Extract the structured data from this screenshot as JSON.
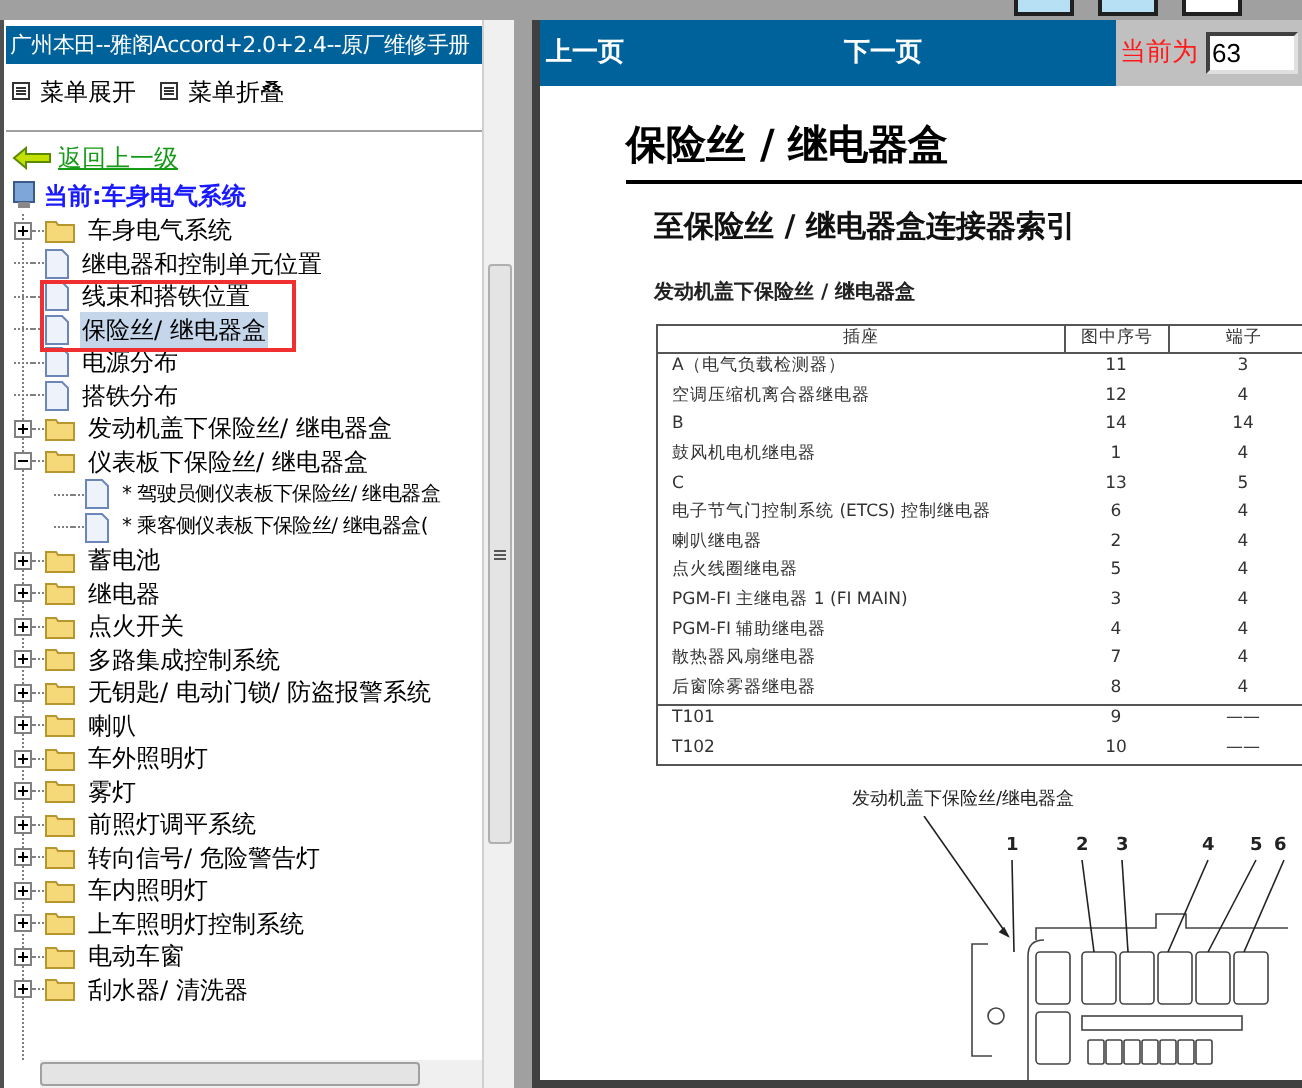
{
  "header": {
    "title": "广州本田--雅阁Accord+2.0+2.4--原厂维修手册"
  },
  "menu": [
    {
      "label": "菜单展开"
    },
    {
      "label": "菜单折叠"
    }
  ],
  "back_link": "返回上一级",
  "current": "当前:车身电气系统",
  "tree": [
    {
      "kind": "folder",
      "label": "车身电气系统",
      "expanded": false,
      "selected": false
    },
    {
      "kind": "doc",
      "label": "继电器和控制单元位置",
      "selected": false
    },
    {
      "kind": "doc",
      "label": "线束和搭铁位置",
      "selected": false
    },
    {
      "kind": "doc",
      "label": "保险丝/ 继电器盒",
      "selected": true
    },
    {
      "kind": "doc",
      "label": "电源分布",
      "selected": false
    },
    {
      "kind": "doc",
      "label": "搭铁分布",
      "selected": false
    },
    {
      "kind": "folder",
      "label": "发动机盖下保险丝/ 继电器盒",
      "expanded": false,
      "selected": false
    },
    {
      "kind": "folder",
      "label": "仪表板下保险丝/ 继电器盒",
      "expanded": true,
      "selected": false,
      "children": [
        {
          "kind": "doc",
          "label": "* 驾驶员侧仪表板下保险丝/ 继电器盒",
          "selected": false
        },
        {
          "kind": "doc",
          "label": "* 乘客侧仪表板下保险丝/ 继电器盒(",
          "selected": false
        }
      ]
    },
    {
      "kind": "folder",
      "label": "蓄电池",
      "expanded": false,
      "selected": false
    },
    {
      "kind": "folder",
      "label": "继电器",
      "expanded": false,
      "selected": false
    },
    {
      "kind": "folder",
      "label": "点火开关",
      "expanded": false,
      "selected": false
    },
    {
      "kind": "folder",
      "label": "多路集成控制系统",
      "expanded": false,
      "selected": false
    },
    {
      "kind": "folder",
      "label": "无钥匙/ 电动门锁/ 防盗报警系统",
      "expanded": false,
      "selected": false
    },
    {
      "kind": "folder",
      "label": "喇叭",
      "expanded": false,
      "selected": false
    },
    {
      "kind": "folder",
      "label": "车外照明灯",
      "expanded": false,
      "selected": false
    },
    {
      "kind": "folder",
      "label": "雾灯",
      "expanded": false,
      "selected": false
    },
    {
      "kind": "folder",
      "label": "前照灯调平系统",
      "expanded": false,
      "selected": false
    },
    {
      "kind": "folder",
      "label": "转向信号/ 危险警告灯",
      "expanded": false,
      "selected": false
    },
    {
      "kind": "folder",
      "label": "车内照明灯",
      "expanded": false,
      "selected": false
    },
    {
      "kind": "folder",
      "label": "上车照明灯控制系统",
      "expanded": false,
      "selected": false
    },
    {
      "kind": "folder",
      "label": "电动车窗",
      "expanded": false,
      "selected": false
    },
    {
      "kind": "folder",
      "label": "刮水器/ 清洗器",
      "expanded": false,
      "selected": false
    }
  ],
  "nav": {
    "prev": "上一页",
    "next": "下一页",
    "current_label": "当前为",
    "page_value": "63"
  },
  "document": {
    "title": "保险丝 / 继电器盒",
    "subtitle": "至保险丝 / 继电器盒连接器索引",
    "section": "发动机盖下保险丝 / 继电器盒",
    "table": {
      "columns": [
        "插座",
        "图中序号",
        "端子"
      ],
      "sections": [
        {
          "rows": [
            [
              "A（电气负载检测器）",
              "11",
              "3"
            ],
            [
              "空调压缩机离合器继电器",
              "12",
              "4"
            ],
            [
              "B",
              "14",
              "14"
            ],
            [
              "鼓风机电机继电器",
              "1",
              "4"
            ],
            [
              "C",
              "13",
              "5"
            ],
            [
              "电子节气门控制系统 (ETCS) 控制继电器",
              "6",
              "4"
            ],
            [
              "喇叭继电器",
              "2",
              "4"
            ],
            [
              "点火线圈继电器",
              "5",
              "4"
            ],
            [
              "PGM-FI 主继电器 1 (FI MAIN)",
              "3",
              "4"
            ],
            [
              "PGM-FI 辅助继电器",
              "4",
              "4"
            ],
            [
              "散热器风扇继电器",
              "7",
              "4"
            ],
            [
              "后窗除雾器继电器",
              "8",
              "4"
            ]
          ]
        },
        {
          "rows": [
            [
              "T101",
              "9",
              "——"
            ],
            [
              "T102",
              "10",
              "——"
            ]
          ]
        }
      ]
    },
    "figure": {
      "caption": "发动机盖下保险丝/继电器盒",
      "callouts": [
        "1",
        "2",
        "3",
        "4",
        "5",
        "6"
      ]
    }
  }
}
